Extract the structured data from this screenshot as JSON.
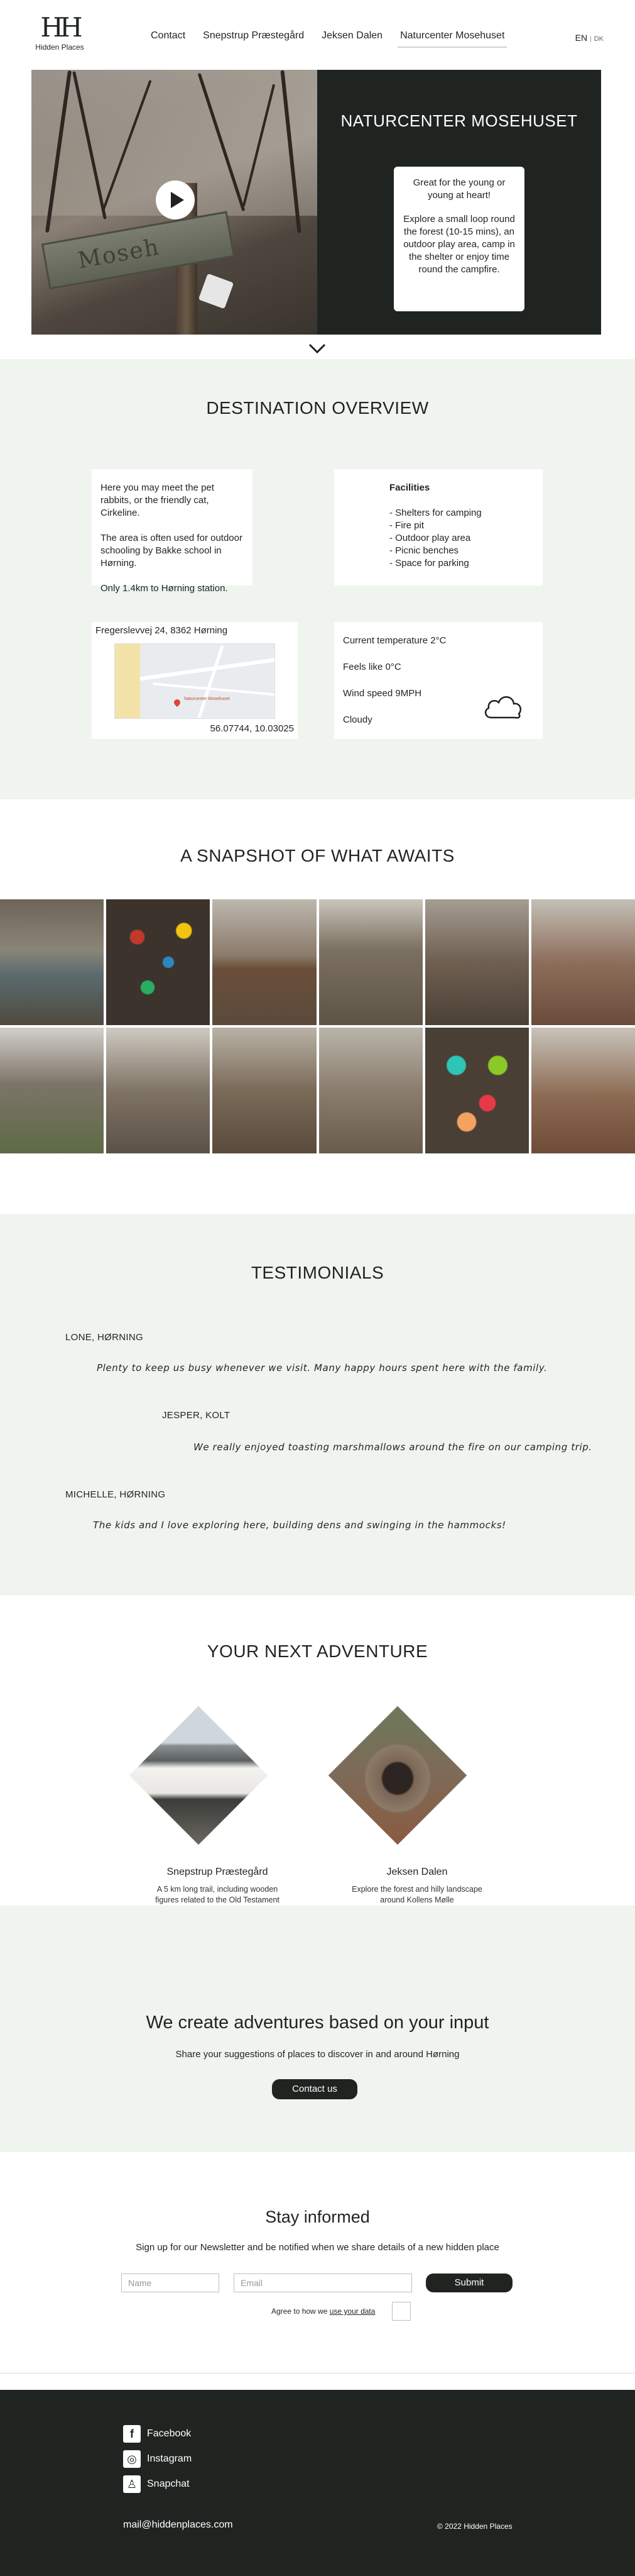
{
  "header": {
    "logo_mark": "H",
    "logo_name": "Hidden Places",
    "nav": [
      {
        "label": "Contact"
      },
      {
        "label": "Snepstrup Præstegård"
      },
      {
        "label": "Jeksen Dalen"
      },
      {
        "label": "Naturcenter Mosehuset",
        "active": true
      }
    ],
    "lang_en": "EN",
    "lang_sep": "|",
    "lang_dk": "DK"
  },
  "hero": {
    "sign_text": "Moseh",
    "title": "NATURCENTER MOSEHUSET",
    "card_line1": "Great for the young or young at heart!",
    "card_line2": "Explore a small loop round the forest (10-15 mins), an outdoor play area, camp in the shelter or enjoy time round the campfire."
  },
  "overview": {
    "title": "DESTINATION OVERVIEW",
    "about": [
      "Here you may meet the pet rabbits, or the friendly cat, Cirkeline.",
      "The area is often used for outdoor schooling by Bakke school in Hørning.",
      "Only 1.4km to Hørning station."
    ],
    "facilities_title": "Facilities",
    "facilities": [
      "- Shelters for camping",
      "- Fire pit",
      "- Outdoor play area",
      "- Picnic benches",
      "- Space for parking"
    ],
    "address": "Fregerslevvej 24, 8362 Hørning",
    "map_label": "Naturcenter Mosehuset",
    "coords": "56.07744, 10.03025",
    "weather": [
      "Current temperature 2°C",
      "Feels like 0°C",
      "Wind speed 9MPH",
      "Cloudy"
    ],
    "weather_icon": "cloud-icon"
  },
  "snapshot": {
    "title": "A SNAPSHOT OF WHAT AWAITS"
  },
  "testimonials": {
    "title": "TESTIMONIALS",
    "items": [
      {
        "name": "LONE, HØRNING",
        "quote": "Plenty to keep us busy whenever we visit. Many happy hours spent here with the family."
      },
      {
        "name": "JESPER, KOLT",
        "quote": "We really enjoyed toasting marshmallows around the fire on our camping trip."
      },
      {
        "name": "MICHELLE, HØRNING",
        "quote": "The kids and I love exploring here, building dens and swinging in the hammocks!"
      }
    ]
  },
  "next": {
    "title": "YOUR NEXT ADVENTURE",
    "items": [
      {
        "name": "Snepstrup Præstegård",
        "desc": "A 5 km long trail, including wooden figures related to the Old Testament"
      },
      {
        "name": "Jeksen Dalen",
        "desc": "Explore the forest and hilly landscape around Kollens Mølle"
      }
    ]
  },
  "create": {
    "title": "We create adventures based on your input",
    "subtitle": "Share your suggestions of places to discover in and around Hørning",
    "button": "Contact us"
  },
  "newsletter": {
    "title": "Stay informed",
    "subtitle": "Sign up for our Newsletter and be notified when we share details of a new hidden place",
    "name_placeholder": "Name",
    "email_placeholder": "Email",
    "submit": "Submit",
    "agree_prefix": "Agree to how we ",
    "agree_link": "use your data"
  },
  "footer": {
    "social": [
      {
        "label": "Facebook",
        "icon": "facebook-icon"
      },
      {
        "label": "Instagram",
        "icon": "instagram-icon"
      },
      {
        "label": "Snapchat",
        "icon": "snapchat-icon"
      }
    ],
    "email": "mail@hiddenplaces.com",
    "copyright": "© 2022 Hidden Places"
  },
  "colors": {
    "dark": "#1f2421",
    "panel": "#f0f4ef",
    "white": "#ffffff"
  }
}
